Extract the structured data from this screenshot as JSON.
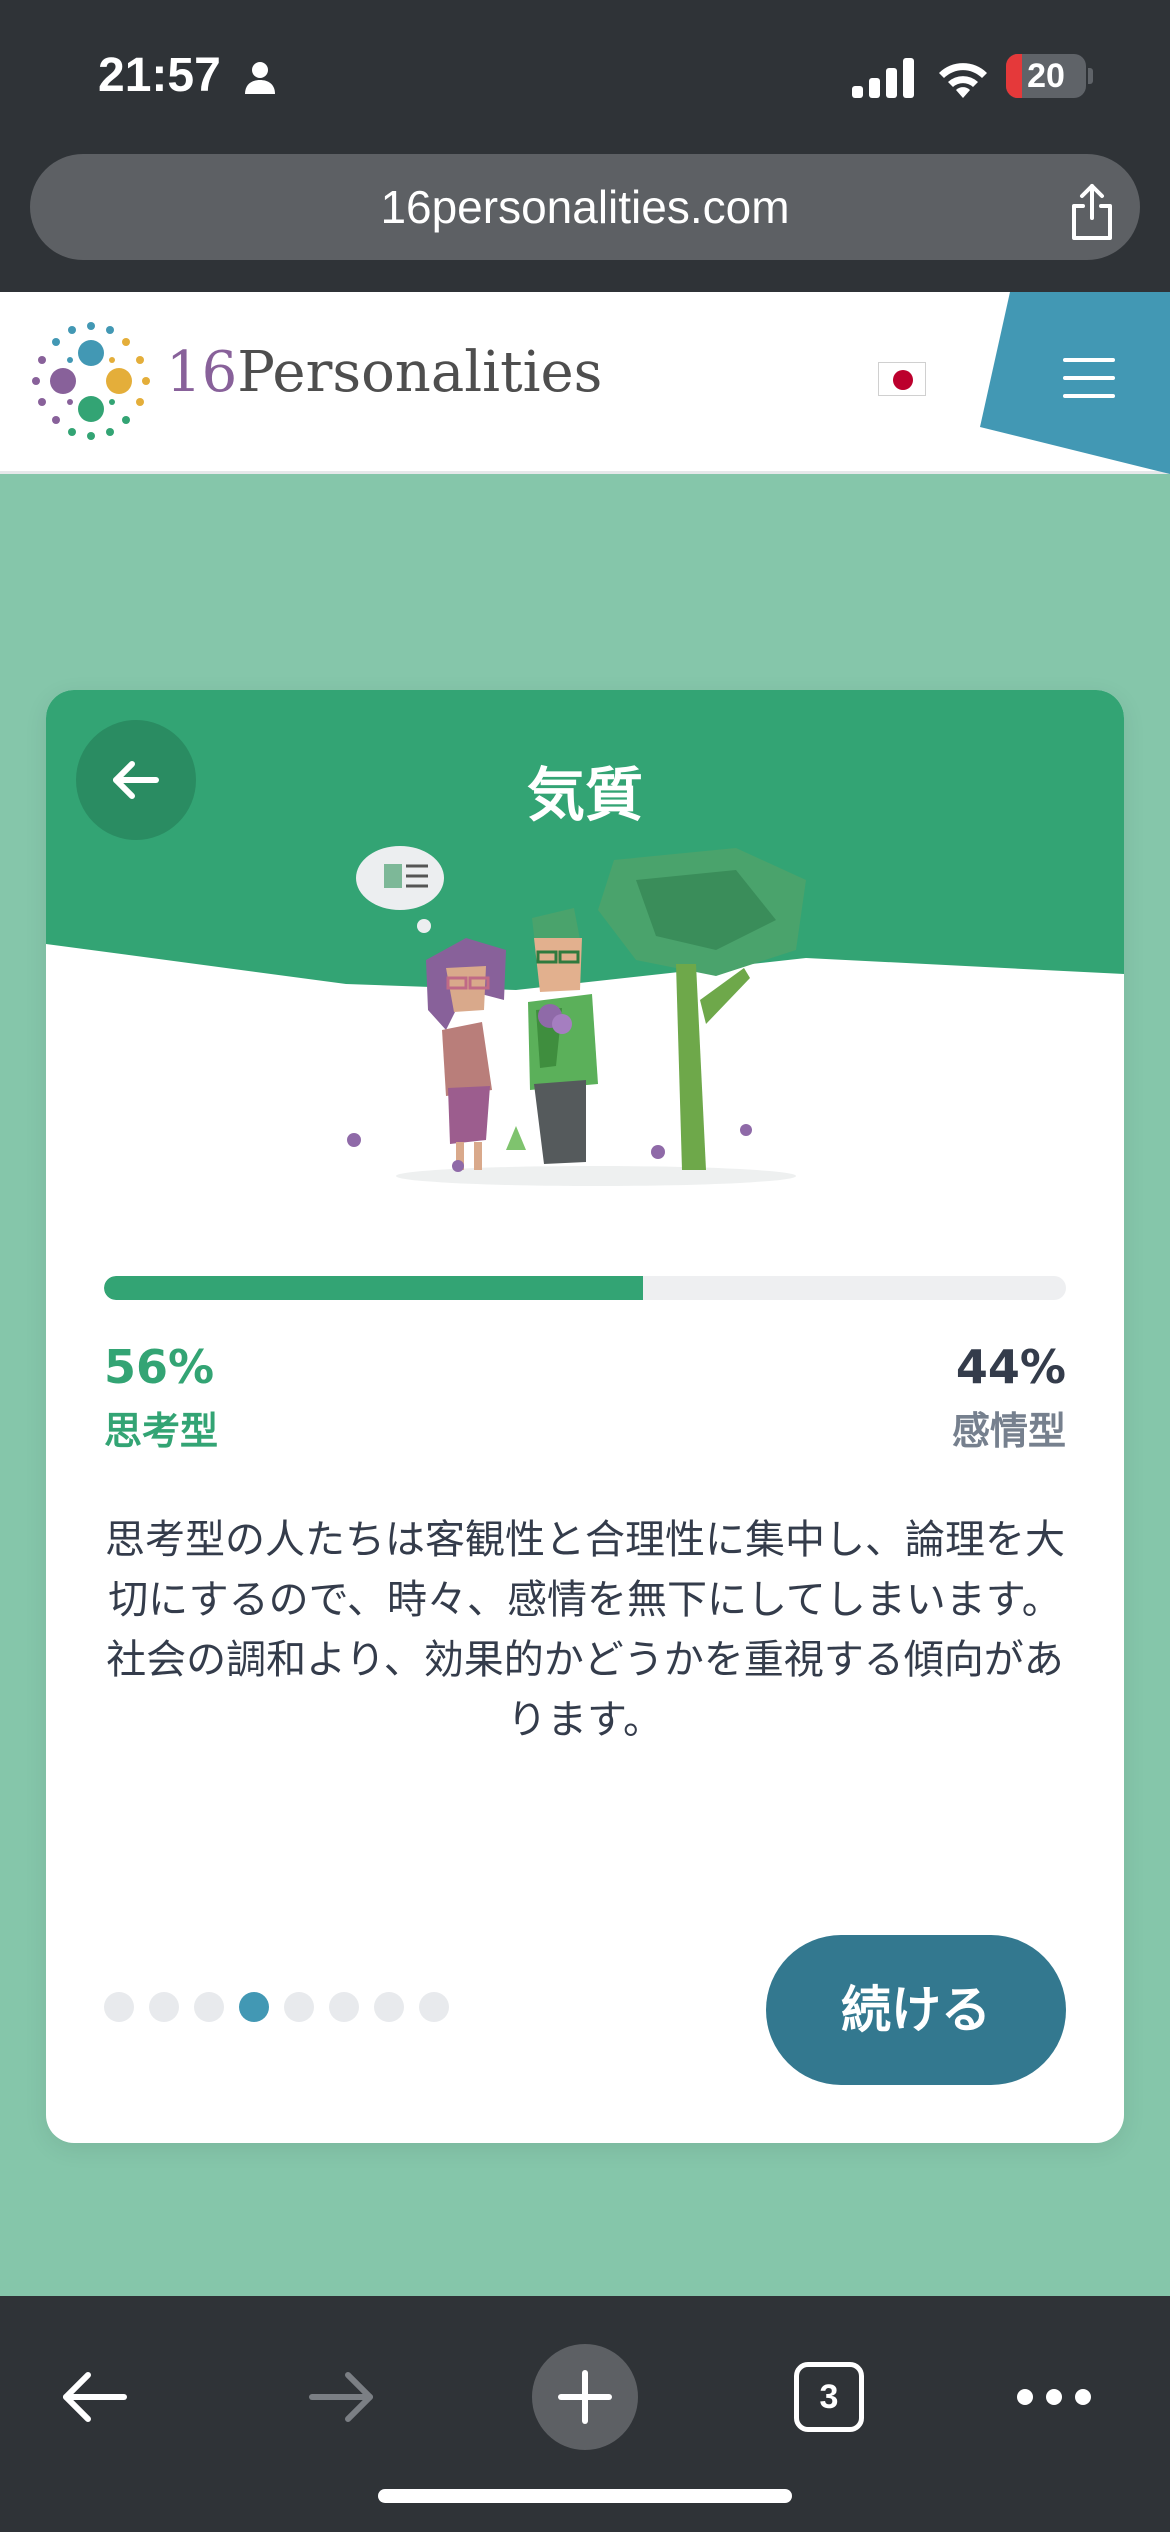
{
  "status_bar": {
    "time": "21:57",
    "battery": "20",
    "battery_level": 0.2,
    "icons": [
      "person-icon",
      "signal-icon",
      "wifi-icon",
      "battery-icon"
    ]
  },
  "browser": {
    "url": "16personalities.com",
    "open_tabs": "3",
    "icons": [
      "share-icon",
      "back-icon",
      "forward-icon",
      "new-tab-icon",
      "tabs-icon",
      "more-icon"
    ]
  },
  "site": {
    "logo_number": "16",
    "logo_text": "Personalities",
    "language_flag": "flag-japan-icon",
    "menu_icon": "hamburger-menu-icon"
  },
  "card": {
    "title": "気質",
    "progress": 0.56,
    "left_percent": "56%",
    "left_label": "思考型",
    "right_percent": "44%",
    "right_label": "感情型",
    "description": "思考型の人たちは客観性と合理性に集中し、論理を大切にするので、時々、感情を無下にしてしまいます。社会の調和より、効果的かどうかを重視する傾向があります。",
    "pagination": {
      "total": 8,
      "current": 4
    },
    "continue_label": "続ける"
  },
  "colors": {
    "green": "#33a474",
    "header_green": "#33a474",
    "background_green": "#85c6aa",
    "button_blue": "#33788f",
    "menu_blue": "#4298b4",
    "browser_chrome": "#2f3337"
  }
}
